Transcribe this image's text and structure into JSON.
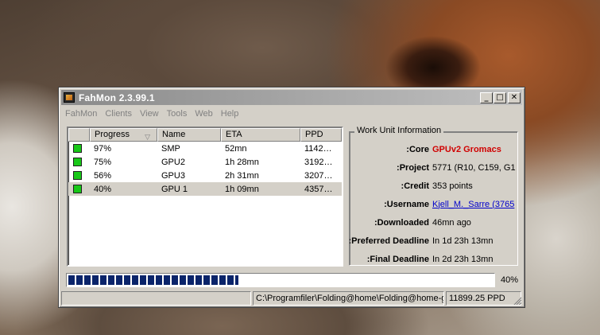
{
  "window": {
    "title": "FahMon 2.3.99.1",
    "buttons": {
      "minimize": "_",
      "maximize": "□",
      "close": "✕"
    }
  },
  "menu": [
    "FahMon",
    "Clients",
    "View",
    "Tools",
    "Web",
    "Help"
  ],
  "table": {
    "columns": [
      "Progress",
      "Name",
      "ETA",
      "PPD"
    ],
    "rows": [
      {
        "status": "ok",
        "progress": "97%",
        "name": "SMP",
        "eta": "52mn",
        "ppd": "1142…"
      },
      {
        "status": "ok",
        "progress": "75%",
        "name": "GPU2",
        "eta": "1h 28mn",
        "ppd": "3192…"
      },
      {
        "status": "ok",
        "progress": "56%",
        "name": "GPU3",
        "eta": "2h 31mn",
        "ppd": "3207…"
      },
      {
        "status": "ok",
        "progress": "40%",
        "name": "GPU 1",
        "eta": "1h 09mn",
        "ppd": "4357…"
      }
    ]
  },
  "work_unit": {
    "legend": "Work Unit Information",
    "fields": [
      {
        "label": "Core:",
        "value": "GPUv2 Gromacs"
      },
      {
        "label": "Project:",
        "value": "5771 (R10, C159, G1"
      },
      {
        "label": "Credit:",
        "value": "353 points"
      },
      {
        "label": "Username:",
        "value": "Kjell_M._Sarre (3765"
      },
      {
        "label": "Downloaded:",
        "value": "46mn ago"
      },
      {
        "label": "Preferred Deadline:",
        "value": "In 1d 23h 13mn"
      },
      {
        "label": "Final Deadline:",
        "value": "In 2d 23h 13mn"
      }
    ]
  },
  "progress": {
    "value": 0.4,
    "label": "40%"
  },
  "statusbar": {
    "left": "",
    "path": "C:\\Programfiler\\Folding@home\\Folding@home-gp",
    "ppd": "11899.25 PPD"
  },
  "colors": {
    "status_ok": "#18c818",
    "progress_fill": "#0a246a",
    "core_text": "#d00000",
    "link": "#0000cc",
    "chrome": "#d4d0c8"
  }
}
